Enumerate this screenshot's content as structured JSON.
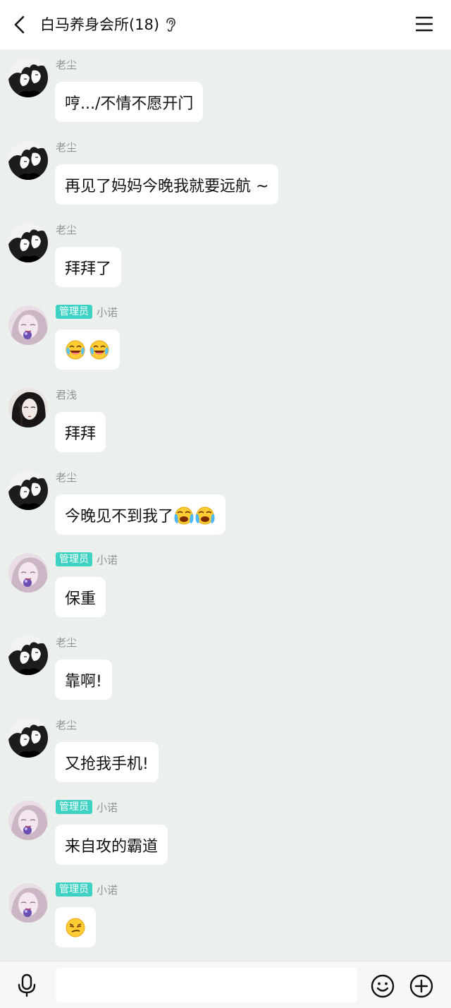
{
  "header": {
    "title": "白马养身会所(18)",
    "icons": [
      "back-arrow-icon",
      "ear-icon",
      "menu-icon"
    ]
  },
  "admin_badge": "管理员",
  "messages": [
    {
      "sender": "老尘",
      "avatar": "bw-couple-avatar",
      "text": "哼.../不情不愿开门"
    },
    {
      "sender": "老尘",
      "avatar": "bw-couple-avatar",
      "text": "再见了妈妈今晚我就要远航 ~"
    },
    {
      "sender": "老尘",
      "avatar": "bw-couple-avatar",
      "text": "拜拜了"
    },
    {
      "sender": "小诺",
      "role": "管理员",
      "avatar": "purple-girl-avatar",
      "text": "",
      "emoji": [
        "laughing-tears-emoji",
        "laughing-tears-emoji"
      ]
    },
    {
      "sender": "君浅",
      "avatar": "dark-hair-girl-avatar",
      "text": "拜拜"
    },
    {
      "sender": "老尘",
      "avatar": "bw-couple-avatar",
      "text": "今晚见不到我了",
      "emoji": [
        "loudly-crying-emoji",
        "loudly-crying-emoji"
      ]
    },
    {
      "sender": "小诺",
      "role": "管理员",
      "avatar": "purple-girl-avatar",
      "text": "保重"
    },
    {
      "sender": "老尘",
      "avatar": "bw-couple-avatar",
      "text": "靠啊!"
    },
    {
      "sender": "老尘",
      "avatar": "bw-couple-avatar",
      "text": "又抢我手机!"
    },
    {
      "sender": "小诺",
      "role": "管理员",
      "avatar": "purple-girl-avatar",
      "text": "来自攻的霸道"
    },
    {
      "sender": "小诺",
      "role": "管理员",
      "avatar": "purple-girl-avatar",
      "text": "",
      "emoji": [
        "smirk-emoji"
      ]
    }
  ],
  "input_bar": {
    "value": "",
    "icons": [
      "microphone-icon",
      "smiley-icon",
      "plus-icon"
    ]
  },
  "colors": {
    "background": "#ecf0ed",
    "bubble": "#ffffff",
    "admin_badge": "#3fd1c4",
    "sender_name": "#8f9591"
  }
}
